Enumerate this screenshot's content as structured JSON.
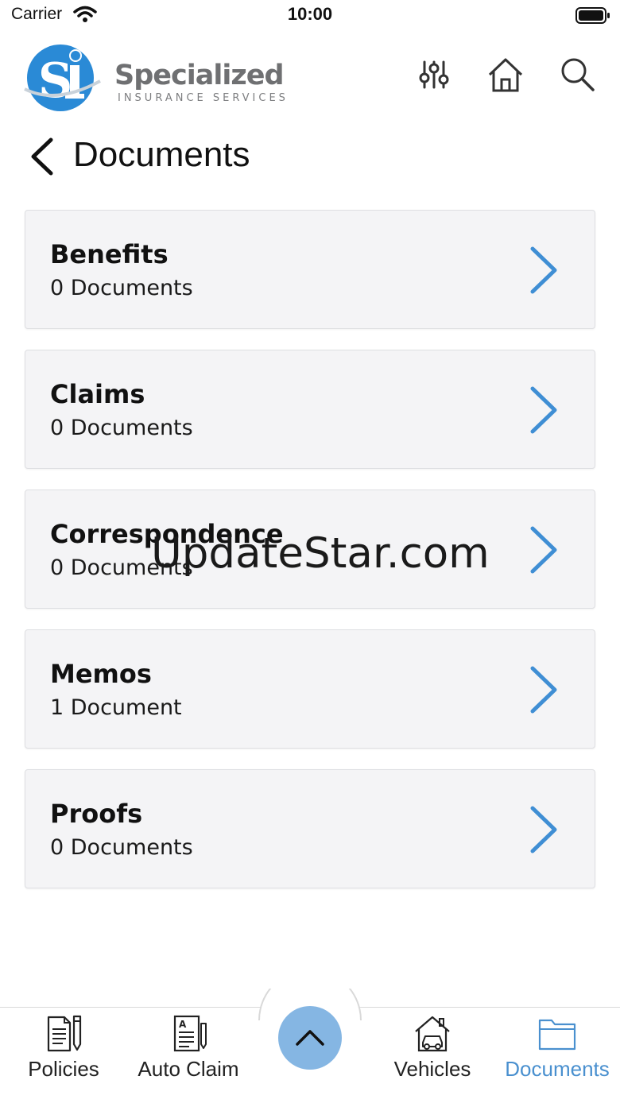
{
  "status_bar": {
    "carrier": "Carrier",
    "time": "10:00"
  },
  "header": {
    "logo_name": "Specialized",
    "logo_tagline": "INSURANCE SERVICES",
    "icons": [
      "filter-sliders-icon",
      "home-icon",
      "search-icon"
    ]
  },
  "page": {
    "title": "Documents"
  },
  "categories": [
    {
      "name": "Benefits",
      "count": "0 Documents"
    },
    {
      "name": "Claims",
      "count": "0 Documents"
    },
    {
      "name": "Correspondence",
      "count": "0 Documents"
    },
    {
      "name": "Memos",
      "count": "1 Document"
    },
    {
      "name": "Proofs",
      "count": "0 Documents"
    }
  ],
  "watermark": "UpdateStar.com",
  "tabbar": {
    "tabs": [
      {
        "label": "Policies",
        "icon": "policy-document-icon",
        "active": false
      },
      {
        "label": "Auto Claim",
        "icon": "claim-form-icon",
        "active": false
      },
      {
        "label": "Vehicles",
        "icon": "house-car-icon",
        "active": false
      },
      {
        "label": "Documents",
        "icon": "folder-icon",
        "active": true
      }
    ],
    "center_button_icon": "chevron-up-icon"
  },
  "colors": {
    "accent": "#4a90cf",
    "card_background": "#f4f4f6",
    "fab": "#85b6e3",
    "logo_blue": "#2a8ad6"
  }
}
